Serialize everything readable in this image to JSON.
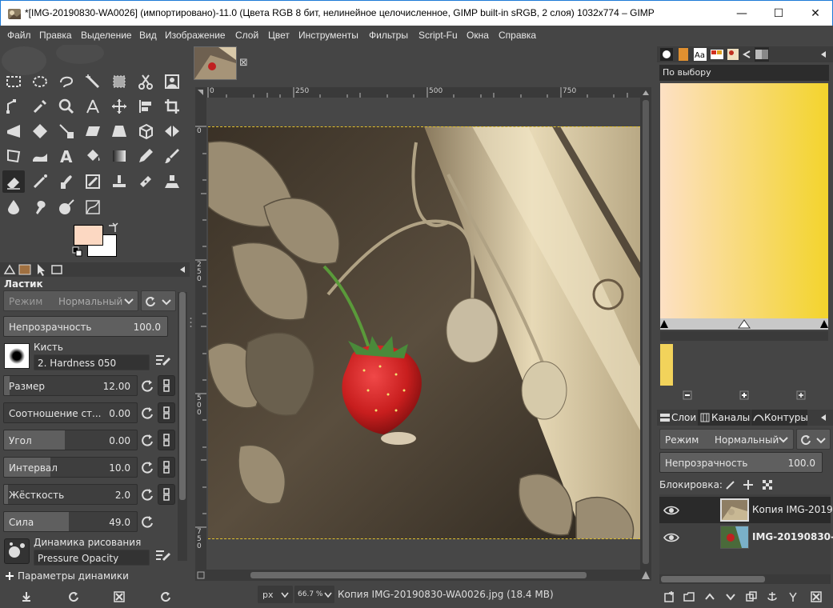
{
  "window": {
    "title": "*[IMG-20190830-WA0026] (импортировано)-11.0 (Цвета RGB 8 бит, нелинейное целочисленное, GIMP built-in sRGB, 2 слоя) 1032x774 – GIMP",
    "minimize_glyph": "—",
    "maximize_glyph": "☐",
    "close_glyph": "✕"
  },
  "menu": [
    "Файл",
    "Правка",
    "Выделение",
    "Вид",
    "Изображение",
    "Слой",
    "Цвет",
    "Инструменты",
    "Фильтры",
    "Script-Fu",
    "Окна",
    "Справка"
  ],
  "colors": {
    "foreground": "#fcd8c2",
    "background": "#ffffff",
    "accent_blue": "#1e7ad6",
    "gradient_start": "#fde0c4",
    "gradient_end": "#f3d42c",
    "swatch": "#f2d35b"
  },
  "tool_options": {
    "title": "Ластик",
    "mode_label": "Режим",
    "mode_value": "Нормальный",
    "opacity_label": "Непрозрачность",
    "opacity_value": "100.0",
    "brush_label": "Кисть",
    "brush_value": "2. Hardness 050",
    "size_label": "Размер",
    "size_value": "12.00",
    "aspect_label": "Соотношение ст...",
    "aspect_value": "0.00",
    "angle_label": "Угол",
    "angle_value": "0.00",
    "spacing_label": "Интервал",
    "spacing_value": "10.0",
    "hardness_label": "Жёсткость",
    "hardness_value": "2.0",
    "force_label": "Сила",
    "force_value": "49.0",
    "dynamics_label": "Динамика рисования",
    "dynamics_value": "Pressure Opacity",
    "dynamics_params_label": "Параметры динамики"
  },
  "image_tab": {
    "close_glyph": "⊠"
  },
  "rulers": {
    "h_labels": [
      "0",
      "250",
      "500",
      "750"
    ],
    "v_labels": [
      "0",
      "2\n5\n0",
      "5\n0\n0",
      "7\n5\n0"
    ]
  },
  "statusbar": {
    "unit": "px",
    "zoom": "66.7 %",
    "file_info": "Копия IMG-20190830-WA0026.jpg (18.4 MB)"
  },
  "gradient_panel": {
    "name": "По выбору"
  },
  "layers_panel": {
    "tabs": [
      "Слои",
      "Каналы",
      "Контуры"
    ],
    "mode_label": "Режим",
    "mode_value": "Нормальный",
    "opacity_label": "Непрозрачность",
    "opacity_value": "100.0",
    "lock_label": "Блокировка:",
    "layers": [
      {
        "name": "Копия IMG-20190",
        "visible": true,
        "bold": false
      },
      {
        "name": "IMG-20190830-",
        "visible": true,
        "bold": true
      }
    ]
  }
}
